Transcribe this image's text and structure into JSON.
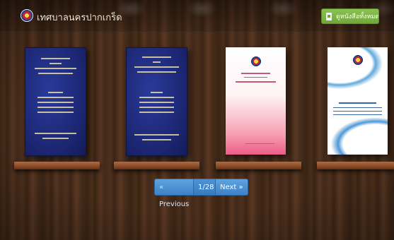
{
  "header": {
    "title": "เทศบาลนครปากเกร็ด",
    "download_label": "ดูหนังสือทั้งหมด"
  },
  "books": [
    {
      "cover": "blue-thesis"
    },
    {
      "cover": "blue-thesis"
    },
    {
      "cover": "pink-report"
    },
    {
      "cover": "blue-wave-report"
    }
  ],
  "pager": {
    "prev_label": "Previous",
    "page_label": "1/28",
    "next_label": "Next"
  },
  "colors": {
    "download_button": "#7ab548",
    "pager": "#4a8fd3",
    "shelf": "#8b4c28"
  }
}
